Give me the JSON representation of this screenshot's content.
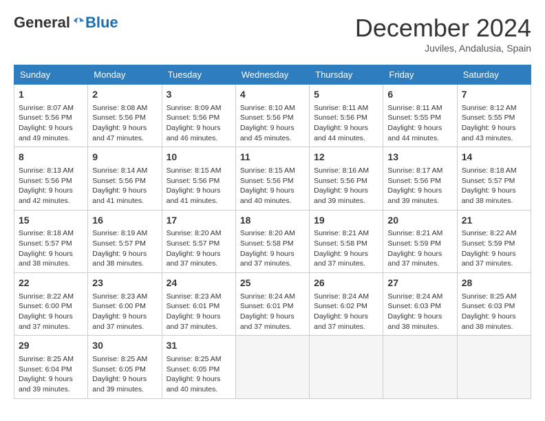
{
  "logo": {
    "general": "General",
    "blue": "Blue"
  },
  "title": "December 2024",
  "location": "Juviles, Andalusia, Spain",
  "days_header": [
    "Sunday",
    "Monday",
    "Tuesday",
    "Wednesday",
    "Thursday",
    "Friday",
    "Saturday"
  ],
  "weeks": [
    [
      {
        "day": "1",
        "info": "Sunrise: 8:07 AM\nSunset: 5:56 PM\nDaylight: 9 hours\nand 49 minutes."
      },
      {
        "day": "2",
        "info": "Sunrise: 8:08 AM\nSunset: 5:56 PM\nDaylight: 9 hours\nand 47 minutes."
      },
      {
        "day": "3",
        "info": "Sunrise: 8:09 AM\nSunset: 5:56 PM\nDaylight: 9 hours\nand 46 minutes."
      },
      {
        "day": "4",
        "info": "Sunrise: 8:10 AM\nSunset: 5:56 PM\nDaylight: 9 hours\nand 45 minutes."
      },
      {
        "day": "5",
        "info": "Sunrise: 8:11 AM\nSunset: 5:56 PM\nDaylight: 9 hours\nand 44 minutes."
      },
      {
        "day": "6",
        "info": "Sunrise: 8:11 AM\nSunset: 5:55 PM\nDaylight: 9 hours\nand 44 minutes."
      },
      {
        "day": "7",
        "info": "Sunrise: 8:12 AM\nSunset: 5:55 PM\nDaylight: 9 hours\nand 43 minutes."
      }
    ],
    [
      {
        "day": "8",
        "info": "Sunrise: 8:13 AM\nSunset: 5:56 PM\nDaylight: 9 hours\nand 42 minutes."
      },
      {
        "day": "9",
        "info": "Sunrise: 8:14 AM\nSunset: 5:56 PM\nDaylight: 9 hours\nand 41 minutes."
      },
      {
        "day": "10",
        "info": "Sunrise: 8:15 AM\nSunset: 5:56 PM\nDaylight: 9 hours\nand 41 minutes."
      },
      {
        "day": "11",
        "info": "Sunrise: 8:15 AM\nSunset: 5:56 PM\nDaylight: 9 hours\nand 40 minutes."
      },
      {
        "day": "12",
        "info": "Sunrise: 8:16 AM\nSunset: 5:56 PM\nDaylight: 9 hours\nand 39 minutes."
      },
      {
        "day": "13",
        "info": "Sunrise: 8:17 AM\nSunset: 5:56 PM\nDaylight: 9 hours\nand 39 minutes."
      },
      {
        "day": "14",
        "info": "Sunrise: 8:18 AM\nSunset: 5:57 PM\nDaylight: 9 hours\nand 38 minutes."
      }
    ],
    [
      {
        "day": "15",
        "info": "Sunrise: 8:18 AM\nSunset: 5:57 PM\nDaylight: 9 hours\nand 38 minutes."
      },
      {
        "day": "16",
        "info": "Sunrise: 8:19 AM\nSunset: 5:57 PM\nDaylight: 9 hours\nand 38 minutes."
      },
      {
        "day": "17",
        "info": "Sunrise: 8:20 AM\nSunset: 5:57 PM\nDaylight: 9 hours\nand 37 minutes."
      },
      {
        "day": "18",
        "info": "Sunrise: 8:20 AM\nSunset: 5:58 PM\nDaylight: 9 hours\nand 37 minutes."
      },
      {
        "day": "19",
        "info": "Sunrise: 8:21 AM\nSunset: 5:58 PM\nDaylight: 9 hours\nand 37 minutes."
      },
      {
        "day": "20",
        "info": "Sunrise: 8:21 AM\nSunset: 5:59 PM\nDaylight: 9 hours\nand 37 minutes."
      },
      {
        "day": "21",
        "info": "Sunrise: 8:22 AM\nSunset: 5:59 PM\nDaylight: 9 hours\nand 37 minutes."
      }
    ],
    [
      {
        "day": "22",
        "info": "Sunrise: 8:22 AM\nSunset: 6:00 PM\nDaylight: 9 hours\nand 37 minutes."
      },
      {
        "day": "23",
        "info": "Sunrise: 8:23 AM\nSunset: 6:00 PM\nDaylight: 9 hours\nand 37 minutes."
      },
      {
        "day": "24",
        "info": "Sunrise: 8:23 AM\nSunset: 6:01 PM\nDaylight: 9 hours\nand 37 minutes."
      },
      {
        "day": "25",
        "info": "Sunrise: 8:24 AM\nSunset: 6:01 PM\nDaylight: 9 hours\nand 37 minutes."
      },
      {
        "day": "26",
        "info": "Sunrise: 8:24 AM\nSunset: 6:02 PM\nDaylight: 9 hours\nand 37 minutes."
      },
      {
        "day": "27",
        "info": "Sunrise: 8:24 AM\nSunset: 6:03 PM\nDaylight: 9 hours\nand 38 minutes."
      },
      {
        "day": "28",
        "info": "Sunrise: 8:25 AM\nSunset: 6:03 PM\nDaylight: 9 hours\nand 38 minutes."
      }
    ],
    [
      {
        "day": "29",
        "info": "Sunrise: 8:25 AM\nSunset: 6:04 PM\nDaylight: 9 hours\nand 39 minutes."
      },
      {
        "day": "30",
        "info": "Sunrise: 8:25 AM\nSunset: 6:05 PM\nDaylight: 9 hours\nand 39 minutes."
      },
      {
        "day": "31",
        "info": "Sunrise: 8:25 AM\nSunset: 6:05 PM\nDaylight: 9 hours\nand 40 minutes."
      },
      {
        "day": "",
        "info": ""
      },
      {
        "day": "",
        "info": ""
      },
      {
        "day": "",
        "info": ""
      },
      {
        "day": "",
        "info": ""
      }
    ]
  ]
}
